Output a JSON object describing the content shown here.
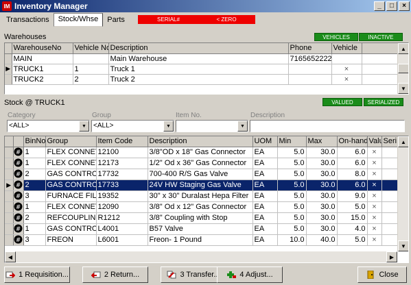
{
  "window": {
    "title": "Inventory Manager",
    "minimize": "_",
    "maximize": "□",
    "close": "×"
  },
  "tabs": [
    {
      "label": "Transactions"
    },
    {
      "label": "Stock/Whse"
    },
    {
      "label": "Parts"
    }
  ],
  "flags": {
    "serial": "SERIAL#",
    "zero": "< ZERO"
  },
  "warehouses": {
    "title": "Warehouses",
    "badges": {
      "vehicles": "VEHICLES",
      "inactive": "INACTIVE"
    },
    "columns": [
      "WarehouseNo",
      "Vehicle No",
      "Description",
      "Phone",
      "Vehicle"
    ],
    "rows": [
      {
        "no": "MAIN",
        "vehicle_no": "",
        "desc": "Main Warehouse",
        "phone": "7165652222",
        "vehicle": ""
      },
      {
        "no": "TRUCK1",
        "vehicle_no": "1",
        "desc": "Truck 1",
        "phone": "",
        "vehicle": "×",
        "current": true
      },
      {
        "no": "TRUCK2",
        "vehicle_no": "2",
        "desc": "Truck 2",
        "phone": "",
        "vehicle": "×"
      }
    ]
  },
  "stock": {
    "title": "Stock @ TRUCK1",
    "badges": {
      "valued": "VALUED",
      "serialized": "SERIALIZED"
    },
    "filters": {
      "category": {
        "label": "Category",
        "value": "<ALL>"
      },
      "group": {
        "label": "Group",
        "value": "<ALL>"
      },
      "item_no": {
        "label": "Item No.",
        "value": ""
      },
      "description": {
        "label": "Description",
        "value": ""
      }
    },
    "columns": [
      "BinNo",
      "Group",
      "Item Code",
      "Description",
      "UOM",
      "Min",
      "Max",
      "On-hand",
      "Valu",
      "Seri"
    ],
    "rows": [
      {
        "bin": "1",
        "group": "FLEX CONNETO",
        "code": "12100",
        "desc": "3/8\"OD x 18\" Gas Connector",
        "uom": "EA",
        "min": "5.0",
        "max": "30.0",
        "onhand": "6.0",
        "valued": "×",
        "serial": ""
      },
      {
        "bin": "1",
        "group": "FLEX CONNETO",
        "code": "12173",
        "desc": "1/2\" Od x 36\" Gas Connector",
        "uom": "EA",
        "min": "5.0",
        "max": "30.0",
        "onhand": "6.0",
        "valued": "×",
        "serial": ""
      },
      {
        "bin": "2",
        "group": "GAS CONTROLS",
        "code": "17732",
        "desc": "700-400 R/S Gas Valve",
        "uom": "EA",
        "min": "5.0",
        "max": "30.0",
        "onhand": "8.0",
        "valued": "×",
        "serial": ""
      },
      {
        "bin": "2",
        "group": "GAS CONTROLS",
        "code": "17733",
        "desc": "24V HW Staging Gas Valve",
        "uom": "EA",
        "min": "5.0",
        "max": "30.0",
        "onhand": "6.0",
        "valued": "×",
        "serial": "",
        "selected": true
      },
      {
        "bin": "3",
        "group": "FURNACE FILTE",
        "code": "19352",
        "desc": "30\" x 30\" Duralast Hepa Filter",
        "uom": "EA",
        "min": "5.0",
        "max": "30.0",
        "onhand": "9.0",
        "valued": "×",
        "serial": ""
      },
      {
        "bin": "1",
        "group": "FLEX CONNETO",
        "code": "12090",
        "desc": "3/8\" Od x 12\" Gas Connector",
        "uom": "EA",
        "min": "5.0",
        "max": "30.0",
        "onhand": "5.0",
        "valued": "×",
        "serial": ""
      },
      {
        "bin": "2",
        "group": "REFCOUPLING",
        "code": "R1212",
        "desc": "3/8\" Coupling with Stop",
        "uom": "EA",
        "min": "5.0",
        "max": "30.0",
        "onhand": "15.0",
        "valued": "×",
        "serial": ""
      },
      {
        "bin": "1",
        "group": "GAS CONTROLS",
        "code": "L4001",
        "desc": "B57 Valve",
        "uom": "EA",
        "min": "5.0",
        "max": "30.0",
        "onhand": "4.0",
        "valued": "×",
        "serial": ""
      },
      {
        "bin": "3",
        "group": "FREON",
        "code": "L6001",
        "desc": "Freon- 1 Pound",
        "uom": "EA",
        "min": "10.0",
        "max": "40.0",
        "onhand": "5.0",
        "valued": "×",
        "serial": ""
      }
    ]
  },
  "buttons": {
    "requisition": "1 Requisition...",
    "return": "2 Return...",
    "transfer": "3 Transfer...",
    "adjust": "4 Adjust...",
    "close": "Close"
  },
  "colors": {
    "flag_red": "#e00000",
    "badge_green": "#1a8c1a",
    "selection": "#0a246a",
    "title_start": "#0a246a",
    "title_end": "#a6caf0"
  }
}
